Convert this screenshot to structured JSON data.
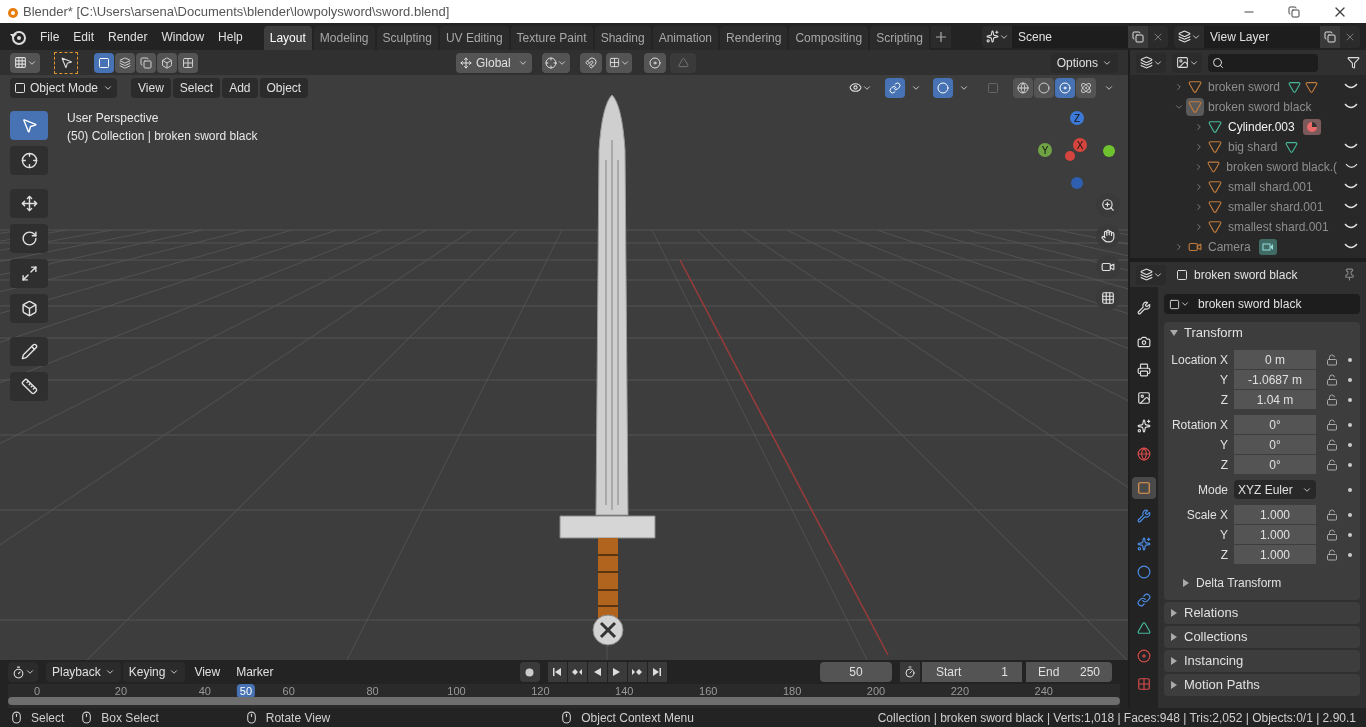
{
  "window": {
    "title": "Blender* [C:\\Users\\arsena\\Documents\\blender\\lowpolysword\\sword.blend]"
  },
  "menu": [
    "File",
    "Edit",
    "Render",
    "Window",
    "Help"
  ],
  "workspaces": [
    {
      "label": "Layout",
      "selected": true
    },
    {
      "label": "Modeling",
      "selected": false
    },
    {
      "label": "Sculpting",
      "selected": false
    },
    {
      "label": "UV Editing",
      "selected": false
    },
    {
      "label": "Texture Paint",
      "selected": false
    },
    {
      "label": "Shading",
      "selected": false
    },
    {
      "label": "Animation",
      "selected": false
    },
    {
      "label": "Rendering",
      "selected": false
    },
    {
      "label": "Compositing",
      "selected": false
    },
    {
      "label": "Scripting",
      "selected": false
    }
  ],
  "scene": {
    "value": "Scene"
  },
  "view_layer": {
    "value": "View Layer"
  },
  "tool_header": {
    "select_modes": [
      {
        "selected": true
      },
      {
        "selected": false
      },
      {
        "selected": false
      },
      {
        "selected": false
      },
      {
        "selected": false
      }
    ],
    "orientation": "Global",
    "options": "Options"
  },
  "viewport_header": {
    "mode": "Object Mode",
    "menus": [
      "View",
      "Select",
      "Add",
      "Object"
    ],
    "gizmos_on": true,
    "overlays_on": true,
    "shading_modes": [
      {
        "selected": false
      },
      {
        "selected": false
      },
      {
        "selected": true
      },
      {
        "selected": false
      }
    ]
  },
  "viewport": {
    "perspective": "User Perspective",
    "collection_info": "(50) Collection | broken sword black",
    "gizmo_axes": [
      "Z",
      "Y",
      "X"
    ]
  },
  "toolbar": [
    {
      "kind": "select",
      "selected": true
    },
    {
      "kind": "cursor",
      "selected": false
    },
    {
      "kind": "move",
      "selected": false
    },
    {
      "kind": "rotate",
      "selected": false
    },
    {
      "kind": "scale",
      "selected": false
    },
    {
      "kind": "transform",
      "selected": false
    },
    {
      "kind": "annotate",
      "selected": false
    },
    {
      "kind": "measure",
      "selected": false
    }
  ],
  "outliner": [
    {
      "name": "broken sword",
      "kind": "object",
      "hidden": true,
      "active": false,
      "expanded": false,
      "data_icons": [
        {
          "kind": "mesh"
        },
        {
          "kind": "object"
        }
      ]
    },
    {
      "name": "broken sword black",
      "kind": "object",
      "hidden": true,
      "active": true,
      "expanded": true,
      "children": [
        {
          "name": "Cylinder.003",
          "kind": "mesh",
          "hidden": false,
          "active": false,
          "expanded": false,
          "data_icons": [
            {
              "kind": "material"
            }
          ]
        },
        {
          "name": "big shard",
          "kind": "object",
          "hidden": true,
          "active": false,
          "expanded": false,
          "data_icons": [
            {
              "kind": "mesh"
            }
          ]
        },
        {
          "name": "broken sword black.(",
          "kind": "object",
          "hidden": true,
          "active": false,
          "expanded": false
        },
        {
          "name": "small shard.001",
          "kind": "object",
          "hidden": true,
          "active": false,
          "expanded": false
        },
        {
          "name": "smaller shard.001",
          "kind": "object",
          "hidden": true,
          "active": false,
          "expanded": false
        },
        {
          "name": "smallest shard.001",
          "kind": "object",
          "hidden": true,
          "active": false,
          "expanded": false
        }
      ]
    },
    {
      "name": "Camera",
      "kind": "camera",
      "hidden": true,
      "active": false,
      "expanded": false,
      "data_icons": [
        {
          "kind": "camera"
        }
      ]
    }
  ],
  "properties": {
    "object_name": "broken sword black",
    "name_field": "broken sword black",
    "tabs": [
      {
        "kind": "tool",
        "selected": false
      },
      {
        "kind": "render",
        "selected": false
      },
      {
        "kind": "output",
        "selected": false
      },
      {
        "kind": "view_layer",
        "selected": false
      },
      {
        "kind": "scene",
        "selected": false
      },
      {
        "kind": "world",
        "selected": false
      },
      {
        "kind": "object",
        "selected": true
      },
      {
        "kind": "modifiers",
        "selected": false
      },
      {
        "kind": "particles",
        "selected": false
      },
      {
        "kind": "physics",
        "selected": false
      },
      {
        "kind": "constraints",
        "selected": false
      },
      {
        "kind": "data",
        "selected": false
      },
      {
        "kind": "material",
        "selected": false
      },
      {
        "kind": "texture",
        "selected": false
      }
    ],
    "transform": {
      "title": "Transform",
      "expanded": true,
      "groups": [
        {
          "kind": "vector",
          "rows": [
            {
              "label": "Location X",
              "value": "0 m"
            },
            {
              "label": "Y",
              "value": "-1.0687 m"
            },
            {
              "label": "Z",
              "value": "1.04 m"
            }
          ]
        },
        {
          "kind": "vector",
          "rows": [
            {
              "label": "Rotation X",
              "value": "0°"
            },
            {
              "label": "Y",
              "value": "0°"
            },
            {
              "label": "Z",
              "value": "0°"
            }
          ]
        },
        {
          "kind": "dropdown",
          "rows": [
            {
              "label": "Mode",
              "value": "XYZ Euler"
            }
          ]
        },
        {
          "kind": "vector",
          "rows": [
            {
              "label": "Scale X",
              "value": "1.000"
            },
            {
              "label": "Y",
              "value": "1.000"
            },
            {
              "label": "Z",
              "value": "1.000"
            }
          ]
        }
      ],
      "subpanels": [
        {
          "title": "Delta Transform",
          "expanded": false
        }
      ]
    },
    "panels": [
      {
        "title": "Relations",
        "expanded": false
      },
      {
        "title": "Collections",
        "expanded": false
      },
      {
        "title": "Instancing",
        "expanded": false
      },
      {
        "title": "Motion Paths",
        "expanded": false
      }
    ]
  },
  "timeline": {
    "menus": [
      {
        "label": "Playback",
        "kind": "dropdown"
      },
      {
        "label": "Keying",
        "kind": "dropdown"
      },
      {
        "label": "View",
        "kind": "menu"
      },
      {
        "label": "Marker",
        "kind": "menu"
      }
    ],
    "current_frame": "50",
    "start_label": "Start",
    "start": "1",
    "end_label": "End",
    "end": "250",
    "ticks": [
      "0",
      "20",
      "40",
      "60",
      "80",
      "100",
      "120",
      "140",
      "160",
      "180",
      "200",
      "220",
      "240"
    ],
    "playhead": {
      "label": "50",
      "level": 0.214
    }
  },
  "status_bar": {
    "hints": [
      {
        "kind": "left",
        "label": "Select"
      },
      {
        "kind": "box",
        "label": "Box Select"
      },
      {
        "kind": "middle",
        "label": "Rotate View"
      },
      {
        "kind": "right",
        "label": "Object Context Menu"
      }
    ],
    "stats": "Collection | broken sword black | Verts:1,018 | Faces:948 | Tris:2,052 | Objects:0/1 | 2.90.1"
  }
}
